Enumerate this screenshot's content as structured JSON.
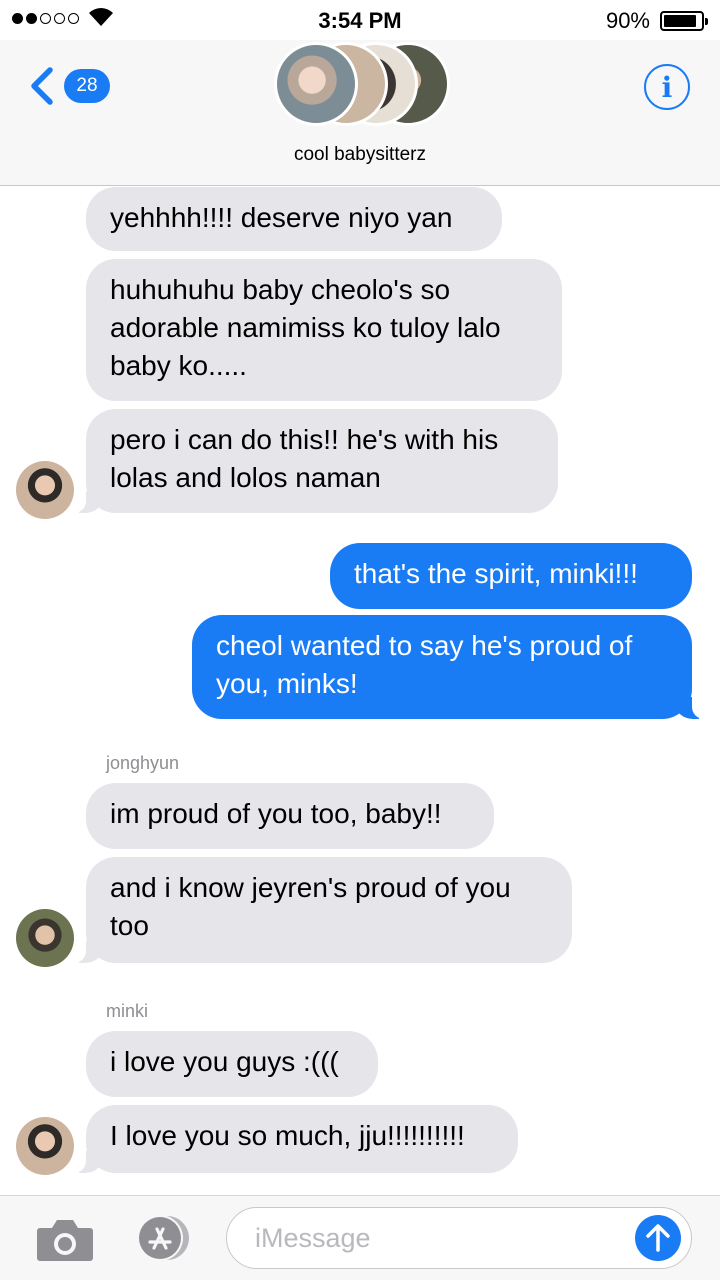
{
  "status_bar": {
    "time": "3:54 PM",
    "battery_percent": "90%",
    "battery_level": 0.9,
    "signal_bars_filled": 2,
    "signal_bars_total": 5,
    "icons": [
      "signal-dots-icon",
      "wifi-icon",
      "battery-icon"
    ]
  },
  "header": {
    "back_count": "28",
    "group_name": "cool babysitterz",
    "info_label": "i",
    "icons": [
      "back-chevron-icon",
      "info-icon"
    ]
  },
  "messages": [
    {
      "direction": "incoming",
      "text": "yehhhh!!!! deserve niyo yan"
    },
    {
      "direction": "incoming",
      "text": "huhuhuhu baby cheolo's so adorable namimiss ko tuloy lalo baby ko....."
    },
    {
      "direction": "incoming",
      "text": "pero i can do this!! he's with his lolas and lolos naman"
    },
    {
      "direction": "outgoing",
      "text": "that's the spirit, minki!!!"
    },
    {
      "direction": "outgoing",
      "text": "cheol wanted to say he's proud of you, minks!"
    },
    {
      "direction": "incoming",
      "sender": "jonghyun",
      "text": "im proud of you too, baby!!"
    },
    {
      "direction": "incoming",
      "text": "and i know jeyren's proud of you too"
    },
    {
      "direction": "incoming",
      "sender": "minki",
      "text": "i love you guys :((("
    },
    {
      "direction": "incoming",
      "text": "I love you so much, jju!!!!!!!!!!"
    }
  ],
  "input_bar": {
    "placeholder": "iMessage",
    "icons": [
      "camera-icon",
      "app-store-icon",
      "send-arrow-icon"
    ]
  },
  "colors": {
    "accent": "#1a7cf5",
    "incoming_bubble": "#e5e5ea",
    "header_bg": "#f7f7f7",
    "sender_label": "#8e8e93"
  }
}
